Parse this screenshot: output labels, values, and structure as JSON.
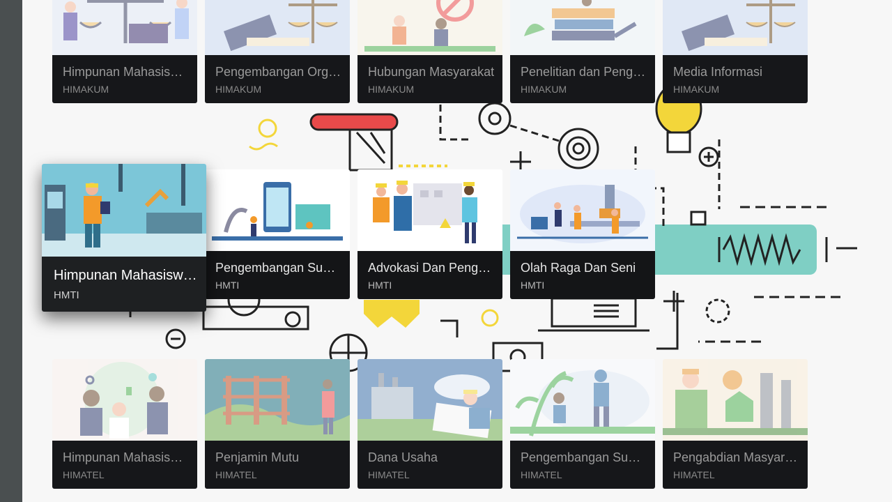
{
  "row1": [
    {
      "title": "Himpunan Mahasiswa ...",
      "org": "HIMAKUM"
    },
    {
      "title": "Pengembangan Organi...",
      "org": "HIMAKUM"
    },
    {
      "title": "Hubungan Masyarakat",
      "org": "HIMAKUM"
    },
    {
      "title": "Penelitian dan Penge...",
      "org": "HIMAKUM"
    },
    {
      "title": "Media Informasi",
      "org": "HIMAKUM"
    }
  ],
  "row2": [
    {
      "title": "Himpunan Mahasiswa ...",
      "org": "HMTI"
    },
    {
      "title": "Pengembangan Sumb...",
      "org": "HMTI"
    },
    {
      "title": "Advokasi Dan Pengab...",
      "org": "HMTI"
    },
    {
      "title": "Olah Raga Dan Seni",
      "org": "HMTI"
    }
  ],
  "row3": [
    {
      "title": "Himpunan Mahasiswa ...",
      "org": "HIMATEL"
    },
    {
      "title": "Penjamin Mutu",
      "org": "HIMATEL"
    },
    {
      "title": "Dana Usaha",
      "org": "HIMATEL"
    },
    {
      "title": "Pengembangan Sumb...",
      "org": "HIMATEL"
    },
    {
      "title": "Pengabdian Masyarak...",
      "org": "HIMATEL"
    }
  ],
  "colors": {
    "background": "#f7f7f7",
    "card_meta": "#141517",
    "accent_teal": "#7fcfc4",
    "accent_red": "#e84a4a",
    "accent_yellow": "#f3d63a"
  }
}
